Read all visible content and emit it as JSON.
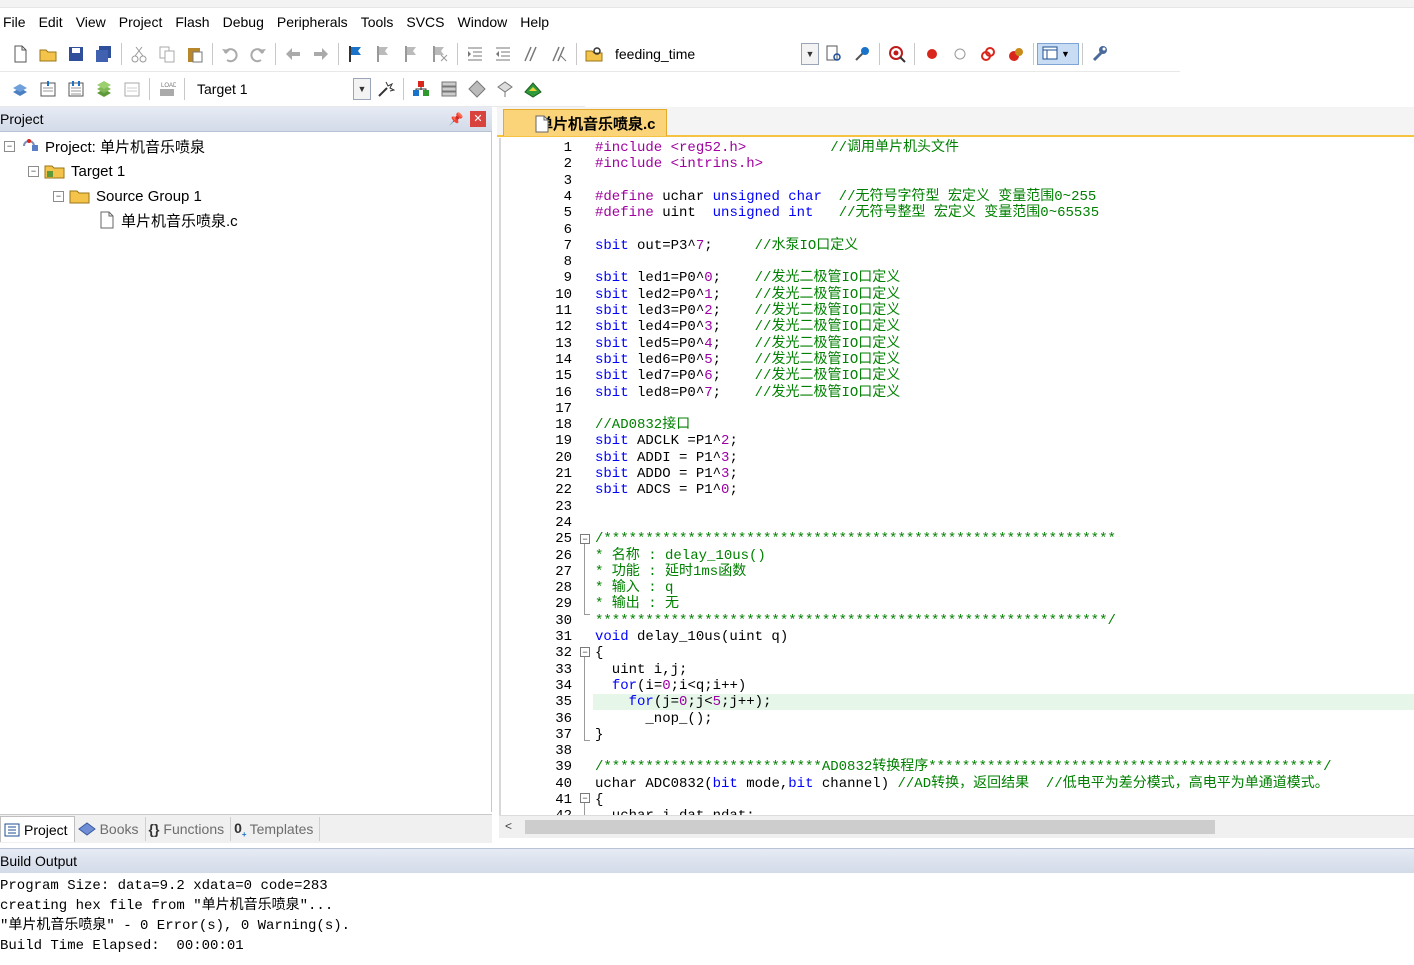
{
  "menu": [
    "File",
    "Edit",
    "View",
    "Project",
    "Flash",
    "Debug",
    "Peripherals",
    "Tools",
    "SVCS",
    "Window",
    "Help"
  ],
  "toolbar": {
    "function_combo": "feeding_time",
    "target_combo": "Target 1"
  },
  "icons": [
    "new-file-icon",
    "open-folder-icon",
    "save-icon",
    "save-all-icon",
    "cut-icon",
    "copy-icon",
    "paste-icon",
    "undo-icon",
    "redo-icon",
    "back-icon",
    "forward-icon",
    "bookmark-icon",
    "find-icon",
    "replace-icon",
    "indent-icon",
    "unindent-icon",
    "comment-icon",
    "uncomment-icon",
    "find-in-files-icon",
    "debug-icon",
    "breakpoint-icon",
    "build-icon",
    "rebuild-icon",
    "download-icon",
    "options-icon"
  ],
  "colors": {
    "accent": "#f5c341",
    "keyword": "#0000ff",
    "comment": "#008000",
    "number": "#9d00a5",
    "panel_header": "#d3dbe9",
    "current_line": "#e6f7ea"
  },
  "project_panel": {
    "title": "Project",
    "tree": {
      "project": "Project: 单片机音乐喷泉",
      "target": "Target 1",
      "group": "Source Group 1",
      "file": "单片机音乐喷泉.c"
    },
    "tabs": [
      "Project",
      "Books",
      "Functions",
      "Templates"
    ]
  },
  "editor": {
    "tab": "单片机音乐喷泉.c",
    "lines": [
      {
        "n": "1",
        "code": [
          [
            "pp",
            "#include <reg52.h>"
          ],
          [
            "tx",
            "          "
          ],
          [
            "cm",
            "//调用单片机头文件"
          ]
        ]
      },
      {
        "n": "2",
        "code": [
          [
            "pp",
            "#include <intrins.h>"
          ]
        ]
      },
      {
        "n": "3",
        "code": []
      },
      {
        "n": "4",
        "code": [
          [
            "pp",
            "#define "
          ],
          [
            "tx",
            "uchar "
          ],
          [
            "kw",
            "unsigned char"
          ],
          [
            "tx",
            "  "
          ],
          [
            "cm",
            "//无符号字符型 宏定义 变量范围0~255"
          ]
        ]
      },
      {
        "n": "5",
        "code": [
          [
            "pp",
            "#define "
          ],
          [
            "tx",
            "uint  "
          ],
          [
            "kw",
            "unsigned int"
          ],
          [
            "tx",
            "   "
          ],
          [
            "cm",
            "//无符号整型 宏定义 变量范围0~65535"
          ]
        ]
      },
      {
        "n": "6",
        "code": []
      },
      {
        "n": "7",
        "code": [
          [
            "kw",
            "sbit"
          ],
          [
            "tx",
            " out=P3^"
          ],
          [
            "num",
            "7"
          ],
          [
            "tx",
            ";     "
          ],
          [
            "cm",
            "//水泵IO口定义"
          ]
        ]
      },
      {
        "n": "8",
        "code": []
      },
      {
        "n": "9",
        "code": [
          [
            "kw",
            "sbit"
          ],
          [
            "tx",
            " led1=P0^"
          ],
          [
            "num",
            "0"
          ],
          [
            "tx",
            ";    "
          ],
          [
            "cm",
            "//发光二极管IO口定义"
          ]
        ]
      },
      {
        "n": "10",
        "code": [
          [
            "kw",
            "sbit"
          ],
          [
            "tx",
            " led2=P0^"
          ],
          [
            "num",
            "1"
          ],
          [
            "tx",
            ";    "
          ],
          [
            "cm",
            "//发光二极管IO口定义"
          ]
        ]
      },
      {
        "n": "11",
        "code": [
          [
            "kw",
            "sbit"
          ],
          [
            "tx",
            " led3=P0^"
          ],
          [
            "num",
            "2"
          ],
          [
            "tx",
            ";    "
          ],
          [
            "cm",
            "//发光二极管IO口定义"
          ]
        ]
      },
      {
        "n": "12",
        "code": [
          [
            "kw",
            "sbit"
          ],
          [
            "tx",
            " led4=P0^"
          ],
          [
            "num",
            "3"
          ],
          [
            "tx",
            ";    "
          ],
          [
            "cm",
            "//发光二极管IO口定义"
          ]
        ]
      },
      {
        "n": "13",
        "code": [
          [
            "kw",
            "sbit"
          ],
          [
            "tx",
            " led5=P0^"
          ],
          [
            "num",
            "4"
          ],
          [
            "tx",
            ";    "
          ],
          [
            "cm",
            "//发光二极管IO口定义"
          ]
        ]
      },
      {
        "n": "14",
        "code": [
          [
            "kw",
            "sbit"
          ],
          [
            "tx",
            " led6=P0^"
          ],
          [
            "num",
            "5"
          ],
          [
            "tx",
            ";    "
          ],
          [
            "cm",
            "//发光二极管IO口定义"
          ]
        ]
      },
      {
        "n": "15",
        "code": [
          [
            "kw",
            "sbit"
          ],
          [
            "tx",
            " led7=P0^"
          ],
          [
            "num",
            "6"
          ],
          [
            "tx",
            ";    "
          ],
          [
            "cm",
            "//发光二极管IO口定义"
          ]
        ]
      },
      {
        "n": "16",
        "code": [
          [
            "kw",
            "sbit"
          ],
          [
            "tx",
            " led8=P0^"
          ],
          [
            "num",
            "7"
          ],
          [
            "tx",
            ";    "
          ],
          [
            "cm",
            "//发光二极管IO口定义"
          ]
        ]
      },
      {
        "n": "17",
        "code": []
      },
      {
        "n": "18",
        "code": [
          [
            "cm",
            "//AD0832接口"
          ]
        ]
      },
      {
        "n": "19",
        "code": [
          [
            "kw",
            "sbit"
          ],
          [
            "tx",
            " ADCLK =P1^"
          ],
          [
            "num",
            "2"
          ],
          [
            "tx",
            ";"
          ]
        ]
      },
      {
        "n": "20",
        "code": [
          [
            "kw",
            "sbit"
          ],
          [
            "tx",
            " ADDI = P1^"
          ],
          [
            "num",
            "3"
          ],
          [
            "tx",
            ";"
          ]
        ]
      },
      {
        "n": "21",
        "code": [
          [
            "kw",
            "sbit"
          ],
          [
            "tx",
            " ADDO = P1^"
          ],
          [
            "num",
            "3"
          ],
          [
            "tx",
            ";"
          ]
        ]
      },
      {
        "n": "22",
        "code": [
          [
            "kw",
            "sbit"
          ],
          [
            "tx",
            " ADCS = P1^"
          ],
          [
            "num",
            "0"
          ],
          [
            "tx",
            ";"
          ]
        ]
      },
      {
        "n": "23",
        "code": []
      },
      {
        "n": "24",
        "code": []
      },
      {
        "n": "25",
        "code": [
          [
            "cm",
            "/*************************************************************"
          ]
        ]
      },
      {
        "n": "26",
        "code": [
          [
            "cm",
            "* 名称 : delay_10us()"
          ]
        ]
      },
      {
        "n": "27",
        "code": [
          [
            "cm",
            "* 功能 : 延时1ms函数"
          ]
        ]
      },
      {
        "n": "28",
        "code": [
          [
            "cm",
            "* 输入 : q"
          ]
        ]
      },
      {
        "n": "29",
        "code": [
          [
            "cm",
            "* 输出 : 无"
          ]
        ]
      },
      {
        "n": "30",
        "code": [
          [
            "cm",
            "*************************************************************/"
          ]
        ]
      },
      {
        "n": "31",
        "code": [
          [
            "kw",
            "void"
          ],
          [
            "tx",
            " delay_10us(uint q)"
          ]
        ]
      },
      {
        "n": "32",
        "code": [
          [
            "tx",
            "{"
          ]
        ]
      },
      {
        "n": "33",
        "code": [
          [
            "tx",
            "  uint i,j;"
          ]
        ]
      },
      {
        "n": "34",
        "code": [
          [
            "tx",
            "  "
          ],
          [
            "kw",
            "for"
          ],
          [
            "tx",
            "(i="
          ],
          [
            "num",
            "0"
          ],
          [
            "tx",
            ";i<q;i++)"
          ]
        ]
      },
      {
        "n": "35",
        "code": [
          [
            "tx",
            "    "
          ],
          [
            "kw",
            "for"
          ],
          [
            "tx",
            "(j="
          ],
          [
            "num",
            "0"
          ],
          [
            "tx",
            ";j<"
          ],
          [
            "num",
            "5"
          ],
          [
            "tx",
            ";j++);"
          ]
        ]
      },
      {
        "n": "36",
        "code": [
          [
            "tx",
            "      _nop_();"
          ]
        ]
      },
      {
        "n": "37",
        "code": [
          [
            "tx",
            "}"
          ]
        ]
      },
      {
        "n": "38",
        "code": []
      },
      {
        "n": "39",
        "code": [
          [
            "cm",
            "/**************************AD0832转换程序***********************************************/"
          ]
        ]
      },
      {
        "n": "40",
        "code": [
          [
            "tx",
            "uchar ADC0832("
          ],
          [
            "kw",
            "bit"
          ],
          [
            "tx",
            " mode,"
          ],
          [
            "kw",
            "bit"
          ],
          [
            "tx",
            " channel) "
          ],
          [
            "cm",
            "//AD转换，返回结果  //低电平为差分模式，高电平为单通道模式。"
          ]
        ]
      },
      {
        "n": "41",
        "code": [
          [
            "tx",
            "{"
          ]
        ]
      },
      {
        "n": "42",
        "code": [
          [
            "tx",
            "  uchar i,dat,ndat;"
          ]
        ]
      }
    ]
  },
  "build_output": {
    "title": "Build Output",
    "lines": [
      "Program Size: data=9.2 xdata=0 code=283",
      "creating hex file from \"单片机音乐喷泉\"...",
      "\"单片机音乐喷泉\" - 0 Error(s), 0 Warning(s).",
      "Build Time Elapsed:  00:00:01"
    ]
  }
}
